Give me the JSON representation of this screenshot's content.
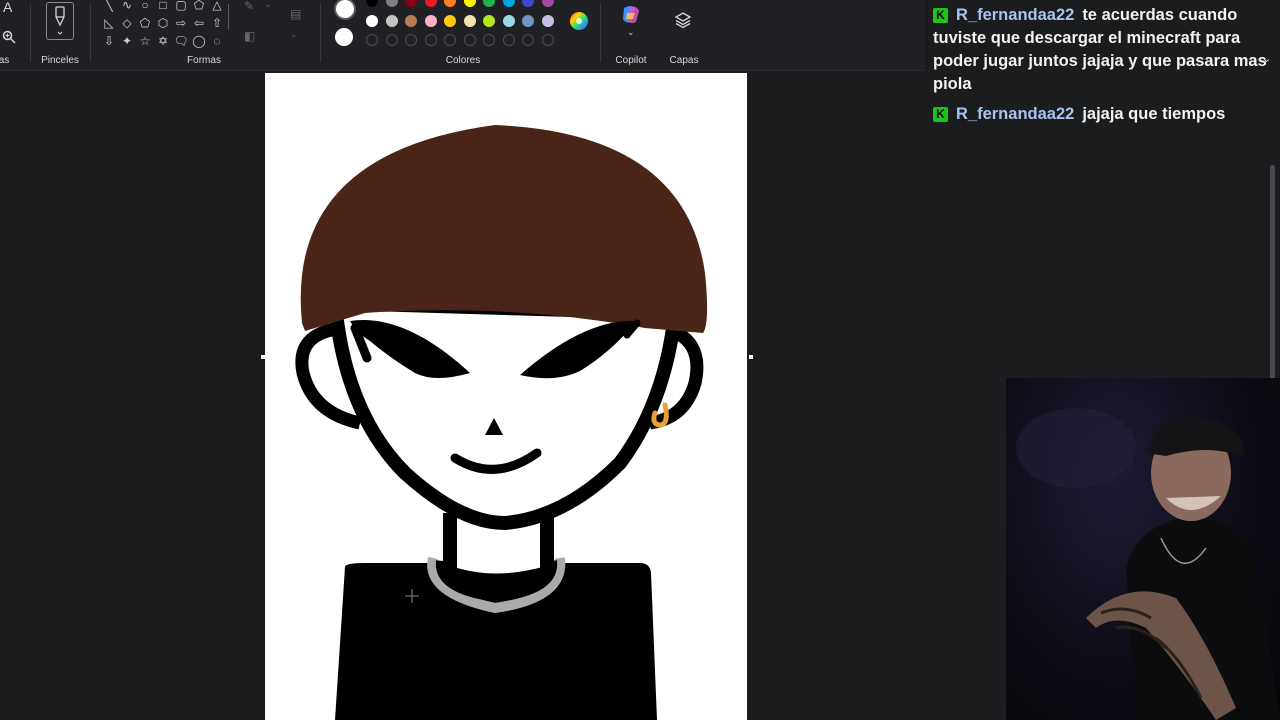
{
  "ribbon": {
    "groups": {
      "brushes": "Pinceles",
      "shapes": "Formas",
      "colors": "Colores",
      "copilot": "Copilot",
      "layers": "Capas"
    },
    "partial_label": "as",
    "icons": [
      "text-tool-icon",
      "zoom-icon",
      "brush-icon",
      "copilot-icon",
      "layers-icon",
      "color-picker-icon",
      "select-icon",
      "crop-icon"
    ]
  },
  "palette": {
    "primary_color": "#ffffff",
    "secondary_color": "#ffffff",
    "row1": [
      "#000000",
      "#7f7f7f",
      "#880015",
      "#ed1c24",
      "#ff7f27",
      "#fff200",
      "#22b14c",
      "#00a2e8",
      "#3f48cc",
      "#a349a4"
    ],
    "row2": [
      "#ffffff",
      "#c3c3c3",
      "#b97a57",
      "#ffaec9",
      "#ffc90e",
      "#efe4b0",
      "#b5e61d",
      "#99d9ea",
      "#7092be",
      "#c8bfe7"
    ]
  },
  "drawing": {
    "hair_color": "#4a2416",
    "outline_color": "#000000",
    "earring_color": "#e8a13a",
    "collar_color": "#aaaaaa"
  },
  "chat": {
    "badge_letter": "K",
    "messages": [
      {
        "user": "R_fernandaa22",
        "text": "te acuerdas cuando tuviste que descargar el minecraft para poder jugar juntos jajaja y que pasara mas piola"
      },
      {
        "user": "R_fernandaa22",
        "text": "jajaja que tiempos"
      }
    ]
  },
  "webcam": {
    "label": "streamer-webcam"
  }
}
